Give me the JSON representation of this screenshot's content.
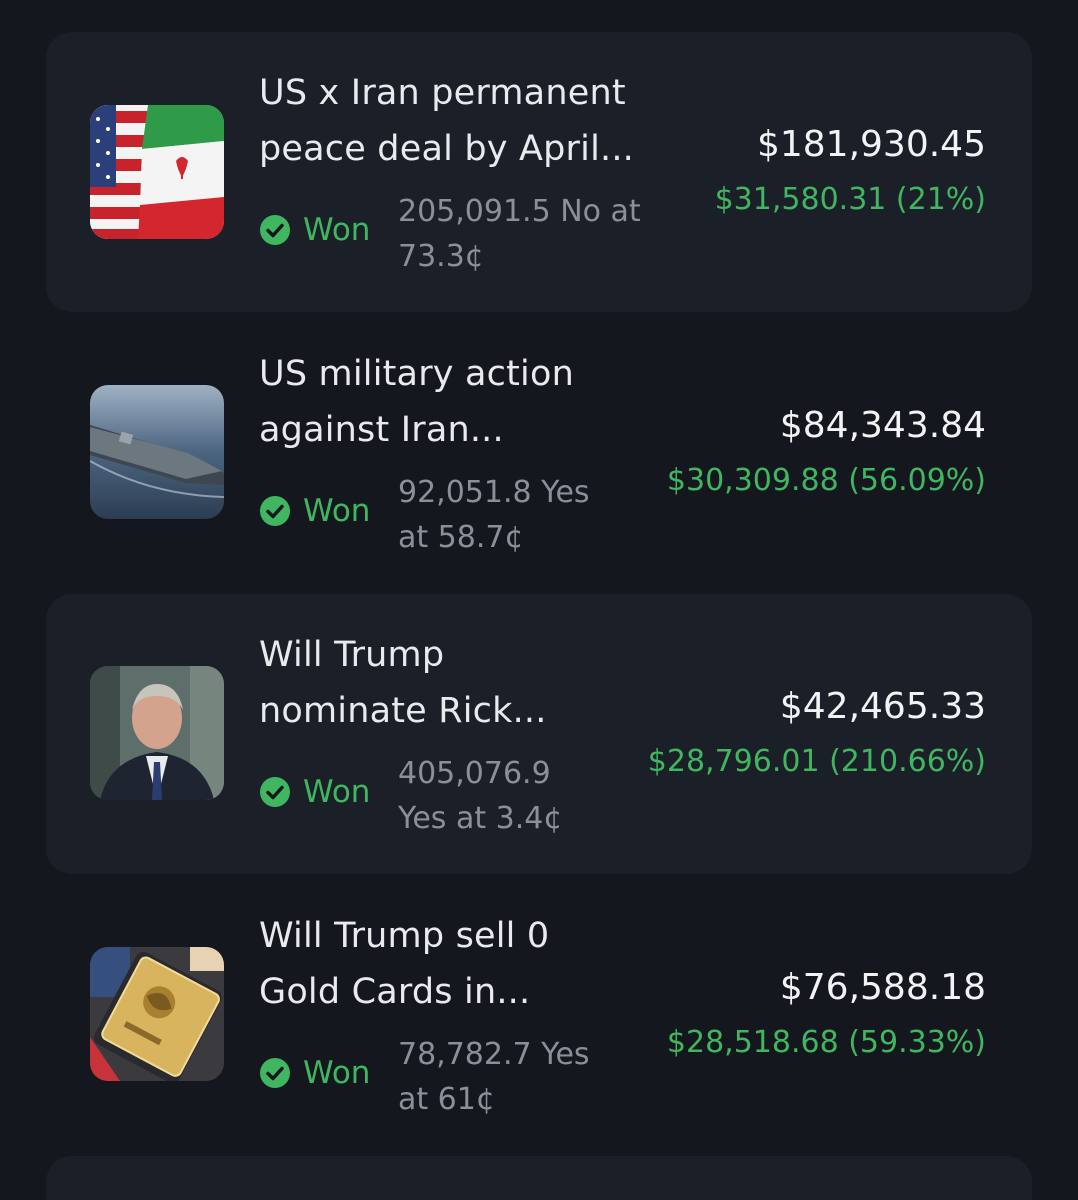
{
  "positions": [
    {
      "title_line1": "US x Iran permanent",
      "title_line2": "peace deal by April...",
      "image": "us-iran-flags-image",
      "status": "Won",
      "shares_line1": "205,091.5 No at",
      "shares_line2": "73.3¢",
      "value": "$181,930.45",
      "pnl": "$31,580.31 (21%)"
    },
    {
      "title_line1": "US military action",
      "title_line2": "against Iran...",
      "image": "aircraft-carrier-image",
      "status": "Won",
      "shares_line1": "92,051.8 Yes",
      "shares_line2": "at 58.7¢",
      "value": "$84,343.84",
      "pnl": "$30,309.88 (56.09%)"
    },
    {
      "title_line1": "Will Trump",
      "title_line2": "nominate Rick...",
      "image": "man-portrait-image",
      "status": "Won",
      "shares_line1": "405,076.9",
      "shares_line2": "Yes at 3.4¢",
      "value": "$42,465.33",
      "pnl": "$28,796.01 (210.66%)"
    },
    {
      "title_line1": "Will Trump sell 0",
      "title_line2": "Gold Cards in...",
      "image": "gold-card-image",
      "status": "Won",
      "shares_line1": "78,782.7 Yes",
      "shares_line2": "at 61¢",
      "value": "$76,588.18",
      "pnl": "$28,518.68 (59.33%)"
    }
  ],
  "colors": {
    "background": "#14171d",
    "card_shaded": "#1b1f27",
    "gain_green": "#3fb65f",
    "muted_text": "#8a8f99"
  }
}
